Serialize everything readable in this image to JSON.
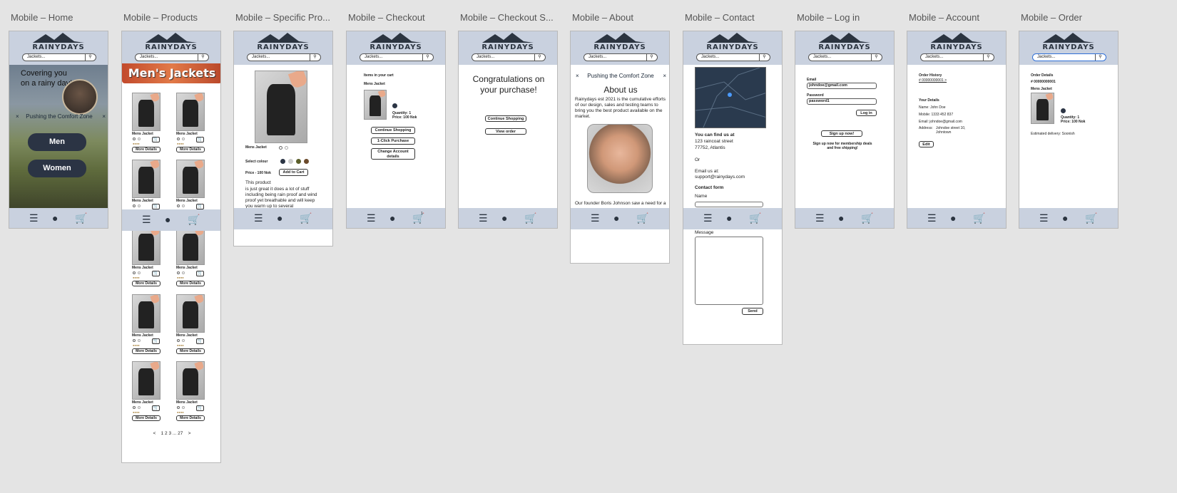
{
  "frames": [
    {
      "title": "Mobile – Home"
    },
    {
      "title": "Mobile – Products"
    },
    {
      "title": "Mobile – Specific Pro..."
    },
    {
      "title": "Mobile – Checkout"
    },
    {
      "title": "Mobile – Checkout S..."
    },
    {
      "title": "Mobile – About"
    },
    {
      "title": "Mobile – Contact"
    },
    {
      "title": "Mobile – Log in"
    },
    {
      "title": "Mobile – Account"
    },
    {
      "title": "Mobile – Order"
    }
  ],
  "common": {
    "logo": "RAINYDAYS",
    "search_placeholder": "Jackets...",
    "menu_icon": "☰",
    "user_icon": "person-icon",
    "cart_icon": "cart-icon"
  },
  "home": {
    "hero_text": "Covering you on a rainy day!",
    "banner": "Pushing the Comfort Zone",
    "banner_close": "×",
    "men": "Men",
    "women": "Women"
  },
  "products": {
    "banner": "Men's Jackets",
    "item_name": "Mens Jacket",
    "details": "More Details",
    "pagination": "1 2 3 ... 27",
    "prev": "<",
    "next": ">"
  },
  "specific": {
    "name": "Mens Jacket",
    "select_colour": "Select colour",
    "price": "Price - 100 Nok",
    "add_to_cart": "Add to Cart",
    "desc_title": "This product",
    "desc": "is just great it does a lot of stuff including being rain proof and wind proof yet breathable and will keep you warm up to several"
  },
  "checkout": {
    "items_label": "Items in your cart",
    "item_name": "Mens Jacket",
    "quantity": "Quantity: 1",
    "price": "Price: 100 Nok",
    "cart_count": "1",
    "continue": "Continue Shopping",
    "one_click": "1-Click Purchase",
    "change": "Change Account details"
  },
  "success": {
    "message": "Congratulations on your purchase!",
    "continue": "Continue Shopping",
    "view_order": "View order"
  },
  "about": {
    "banner": "Pushing the Comfort Zone",
    "title": "About us",
    "text": "Rainydays est 2021 is the cumulative efforts of our design, sales and testing teams to bring you the best product available on the market.",
    "caption": "Our founder Boris Johnson saw a need for a more affordable mode of"
  },
  "contact": {
    "find_us": "You can find us at",
    "address1": "123 raincoat street",
    "address2": "77752, Atlantis",
    "or": "Or",
    "email_label": "Email us at:",
    "email": "support@rainydays.com",
    "form_title": "Contact form",
    "name_label": "Name",
    "message_label": "Message",
    "send": "Send"
  },
  "login": {
    "email_label": "Email",
    "email_value": "johndoe@gmail.com",
    "password_label": "Password",
    "password_value": "password1",
    "login": "Log in",
    "signup": "Sign up now!",
    "signup_note": "Sign up now for membership deals and free shipping!"
  },
  "account": {
    "history_label": "Order History",
    "order_link": "# 00000000001 >",
    "details_label": "Your Details",
    "name": "Name: John Doe",
    "mobile": "Mobile: 1333 452 837",
    "email": "Email: johndoe@gmail.com",
    "address_label": "Address:",
    "address": "Johndoe street 10, Johntown",
    "edit": "Edit"
  },
  "order": {
    "title": "Order Details",
    "number": "# 00000000001",
    "item_name": "Mens Jacket",
    "quantity": "Quantity: 1",
    "price": "Price: 100 Nok",
    "delivery": "Estimated delivery: Soonish"
  }
}
